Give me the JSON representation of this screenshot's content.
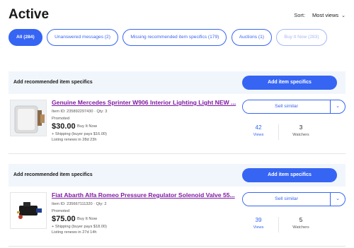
{
  "page": {
    "title": "Active"
  },
  "sort": {
    "label": "Sort:",
    "value": "Most views"
  },
  "filters": [
    {
      "label": "All (284)",
      "active": true
    },
    {
      "label": "Unanswered messages (2)"
    },
    {
      "label": "Missing recommended item specifics (179)"
    },
    {
      "label": "Auctions (1)"
    },
    {
      "label": "Buy It Now (283)"
    }
  ],
  "banner": {
    "label": "Add recommended item specifics",
    "button": "Add item specifics"
  },
  "items": [
    {
      "title": "Genuine Mercedes Sprinter W906 Interior Lighting Light NEW ...",
      "id_line": "Item ID: 235892297430 · Qty: 3",
      "promoted": "Promoted",
      "price": "$30.00",
      "format": "Buy It Now",
      "shipping": "+ Shipping (buyer pays $16.00)",
      "renews": "Listing renews in 28d 23h",
      "sell_similar": "Sell similar",
      "views": "42",
      "views_label": "Views",
      "watchers": "3",
      "watchers_label": "Watchers"
    },
    {
      "title": "Fiat Abarth Alfa Romeo Pressure Regulator Solenoid Valve 55...",
      "id_line": "Item ID: 235667111320 · Qty: 2",
      "promoted": "Promoted",
      "price": "$75.00",
      "format": "Buy It Now",
      "shipping": "+ Shipping (buyer pays $18.00)",
      "renews": "Listing renews in 27d 14h",
      "sell_similar": "Sell similar",
      "views": "39",
      "views_label": "Views",
      "watchers": "5",
      "watchers_label": "Watchers"
    }
  ],
  "colors": {
    "accent": "#3665f3",
    "link_visited": "#7f1aa0",
    "banner_bg": "#f1f6fc"
  }
}
